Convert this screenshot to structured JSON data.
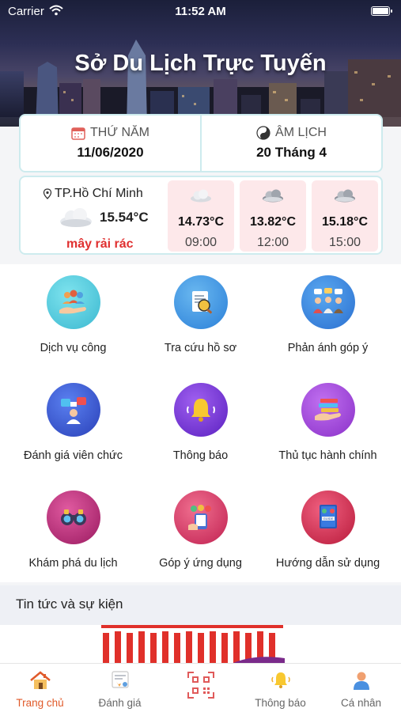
{
  "status_bar": {
    "carrier": "Carrier",
    "time": "11:52 AM"
  },
  "header": {
    "title": "Sở Du Lịch Trực Tuyến"
  },
  "date": {
    "weekday_label": "THỨ NĂM",
    "solar_date": "11/06/2020",
    "lunar_label": "ÂM LỊCH",
    "lunar_date": "20 Tháng 4"
  },
  "weather": {
    "location": "TP.Hồ Chí Minh",
    "current_temp": "15.54°C",
    "description": "mây rải rác",
    "forecast": [
      {
        "temp": "14.73°C",
        "time": "09:00",
        "icon": "cloud-icon"
      },
      {
        "temp": "13.82°C",
        "time": "12:00",
        "icon": "cloud-icon"
      },
      {
        "temp": "15.18°C",
        "time": "15:00",
        "icon": "cloud-icon"
      }
    ]
  },
  "menu": [
    {
      "label": "Dịch vụ công",
      "icon": "public-service-icon",
      "color": "#4cc9dc"
    },
    {
      "label": "Tra cứu hồ sơ",
      "icon": "document-search-icon",
      "color": "#2f8fe0"
    },
    {
      "label": "Phản ánh góp ý",
      "icon": "feedback-people-icon",
      "color": "#2f8fe0"
    },
    {
      "label": "Đánh giá viên chức",
      "icon": "official-rating-icon",
      "color": "#3a4fc8"
    },
    {
      "label": "Thông báo",
      "icon": "bell-icon",
      "color": "#7a3fd0"
    },
    {
      "label": "Thủ tục hành chính",
      "icon": "books-icon",
      "color": "#9a3fd0"
    },
    {
      "label": "Khám phá du lịch",
      "icon": "binoculars-icon",
      "color": "#c42a7a"
    },
    {
      "label": "Góp ý ứng dụng",
      "icon": "app-feedback-icon",
      "color": "#e0406a"
    },
    {
      "label": "Hướng dẫn sử dụng",
      "icon": "guide-book-icon",
      "color": "#e0305a"
    }
  ],
  "news": {
    "title": "Tin tức và sự kiện"
  },
  "tabbar": {
    "tabs": [
      {
        "label": "Trang chủ",
        "icon": "home-icon",
        "active": true
      },
      {
        "label": "Đánh giá",
        "icon": "rating-icon",
        "active": false
      },
      {
        "label": "",
        "icon": "qr-code-icon",
        "active": false
      },
      {
        "label": "Thông báo",
        "icon": "bell-icon",
        "active": false
      },
      {
        "label": "Cá nhân",
        "icon": "user-icon",
        "active": false
      }
    ],
    "active_color": "#e05a2a"
  }
}
